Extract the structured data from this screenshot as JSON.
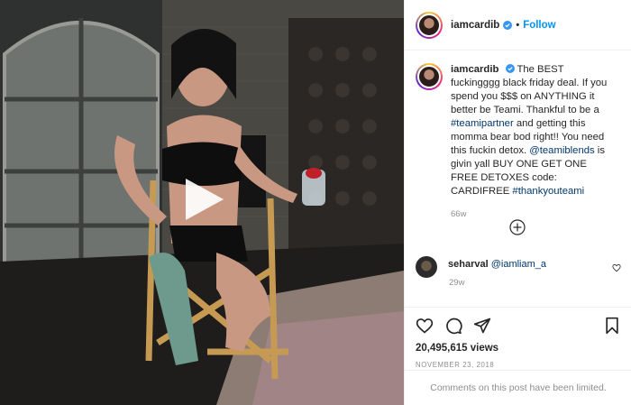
{
  "header": {
    "username": "iamcardib",
    "follow_label": "Follow",
    "separator": "•"
  },
  "caption": {
    "username": "iamcardib",
    "text_part1": "The BEST fuckingggg black friday deal. If you spend you $$$ on ANYTHING it better be Teami. Thankful to be a ",
    "hashtag1": "#teamipartner",
    "text_part2": " and getting this momma bear bod right!! You need this fuckin detox. ",
    "mention": "@teamiblends",
    "text_part3": " is givin yall BUY ONE GET ONE FREE DETOXES code: CARDIFREE ",
    "hashtag2": "#thankyouteami",
    "time": "66w"
  },
  "comment": {
    "username": "seharval",
    "mention": "@iamliam_a",
    "time": "29w"
  },
  "stats": {
    "views": "20,495,615 views",
    "date": "NOVEMBER 23, 2018"
  },
  "footer": {
    "comments_limited": "Comments on this post have been limited."
  },
  "colors": {
    "accent_blue": "#0095f6",
    "link_blue": "#00376b",
    "muted_gray": "#8e8e8e",
    "verified_blue": "#3897f0"
  },
  "icons": [
    "play-icon",
    "verified-badge-icon",
    "plus-circle-icon",
    "heart-icon",
    "comment-icon",
    "share-icon",
    "bookmark-icon"
  ]
}
